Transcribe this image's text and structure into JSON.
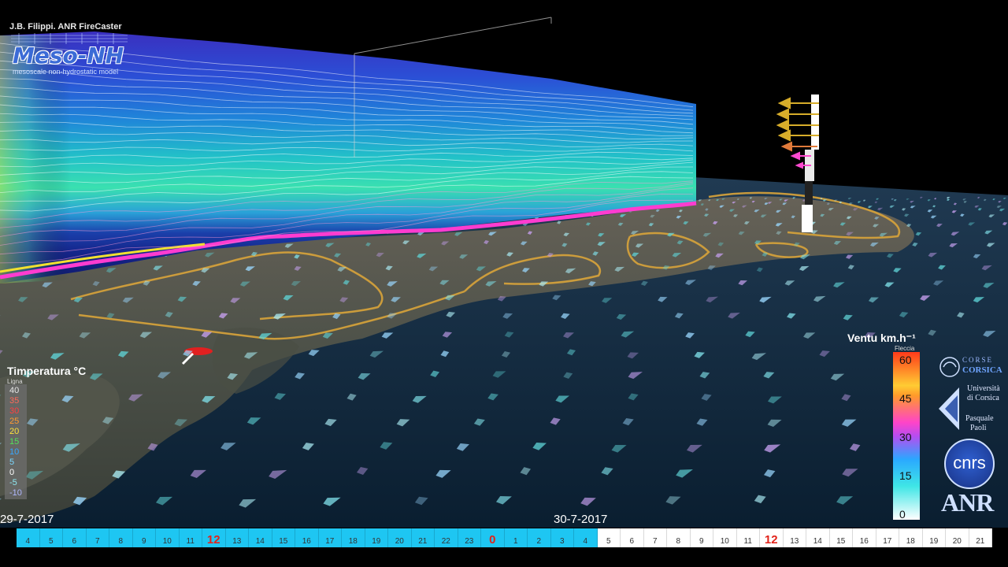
{
  "credit": "J.B. Filippi. ANR FireCaster",
  "logo": {
    "title": "Meso-NH",
    "subtitle": "mesoscale non-hydrostatic model"
  },
  "temperature_legend": {
    "title": "Timperatura °C",
    "subtitle": "Ligna",
    "values": [
      {
        "label": "40",
        "color": "#e6e6e6"
      },
      {
        "label": "35",
        "color": "#ff6a5a"
      },
      {
        "label": "30",
        "color": "#ff4040"
      },
      {
        "label": "25",
        "color": "#ff9a30"
      },
      {
        "label": "20",
        "color": "#ffe23a"
      },
      {
        "label": "15",
        "color": "#54e05a"
      },
      {
        "label": "10",
        "color": "#37a8ff"
      },
      {
        "label": "5",
        "color": "#7ad8ff"
      },
      {
        "label": "0",
        "color": "#ffffff"
      },
      {
        "label": "-5",
        "color": "#8fe8f0"
      },
      {
        "label": "-10",
        "color": "#b0b8ff"
      }
    ]
  },
  "wind_legend": {
    "title": "Ventu km.h⁻¹",
    "subtitle": "Fleccia",
    "values": [
      "60",
      "45",
      "30",
      "15",
      "0"
    ]
  },
  "sponsors": {
    "corse_top": "CORSE",
    "corse_bottom": "CORSICA",
    "univ_lines": [
      "Università",
      "di Corsica",
      "Pasquale",
      "Paoli"
    ],
    "cnrs": "cnrs",
    "anr": "ANR"
  },
  "timeline": {
    "date_start": "29-7-2017",
    "date_mid": "30-7-2017",
    "hours_past": [
      "4",
      "5",
      "6",
      "7",
      "8",
      "9",
      "10",
      "11",
      "12",
      "13",
      "14",
      "15",
      "16",
      "17",
      "18",
      "19",
      "20",
      "21",
      "22",
      "23",
      "0",
      "1",
      "2",
      "3",
      "4"
    ],
    "hours_future": [
      "5",
      "6",
      "7",
      "8",
      "9",
      "10",
      "11",
      "12",
      "13",
      "14",
      "15",
      "16",
      "17",
      "18",
      "19",
      "20",
      "21"
    ],
    "major_hours": [
      "12",
      "0"
    ]
  },
  "colors": {
    "past": "#1ec6f2",
    "future": "#ffffff",
    "major_text": "#e2231a",
    "coast_contour": "#d9a43a",
    "sea": "#0b2238"
  },
  "icons": [
    "wind-arrow-icon",
    "coastline-contour",
    "fire-marker-icon",
    "wind-profile-mast-icon"
  ]
}
